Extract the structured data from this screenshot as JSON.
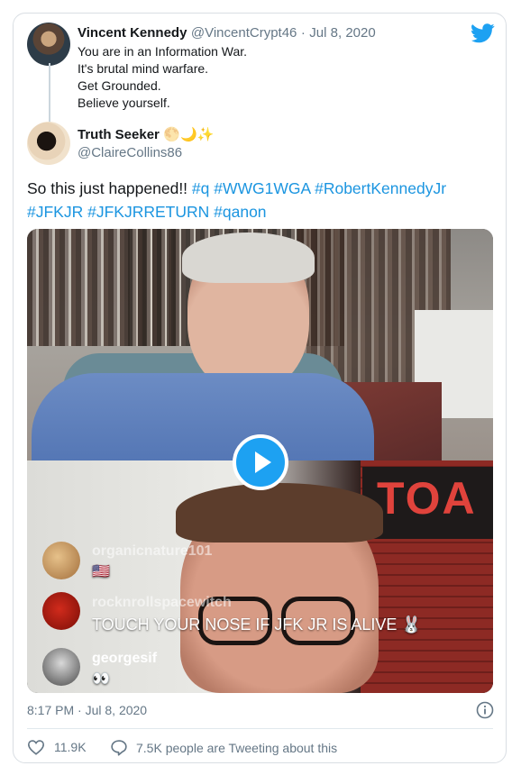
{
  "quoted_tweet": {
    "name": "Vincent Kennedy",
    "handle": "@VincentCrypt46",
    "date": "Jul 8, 2020",
    "separator": "·",
    "lines": [
      "You are in an Information War.",
      "It's brutal mind warfare.",
      "Get Grounded.",
      "Believe yourself."
    ]
  },
  "tweet": {
    "name": "Truth Seeker",
    "name_emojis": "🌕🌙✨",
    "handle": "@ClaireCollins86",
    "text_plain": "So this just happened!!",
    "hashtags_line1": [
      "#q",
      "#WWG1WGA",
      "#RobertKennedyJr"
    ],
    "hashtags_line2": [
      "#JFKJR",
      "#JFKJRRETURN",
      "#qanon"
    ]
  },
  "video_overlay": {
    "sign_text": "TOA",
    "comments": [
      {
        "user": "organicnature101",
        "message": "🇺🇸"
      },
      {
        "user": "rocknrollspacewitch",
        "message": "TOUCH YOUR NOSE IF JFK JR IS ALIVE 🐰"
      },
      {
        "user": "georgesif",
        "message": "👀"
      }
    ]
  },
  "footer": {
    "time": "8:17 PM",
    "date": "Jul 8, 2020",
    "separator": "·",
    "likes": "11.9K",
    "replies_text": "7.5K people are Tweeting about this"
  },
  "colors": {
    "twitter_blue": "#1da1f2",
    "link": "#1b95e0",
    "muted": "#657786"
  }
}
